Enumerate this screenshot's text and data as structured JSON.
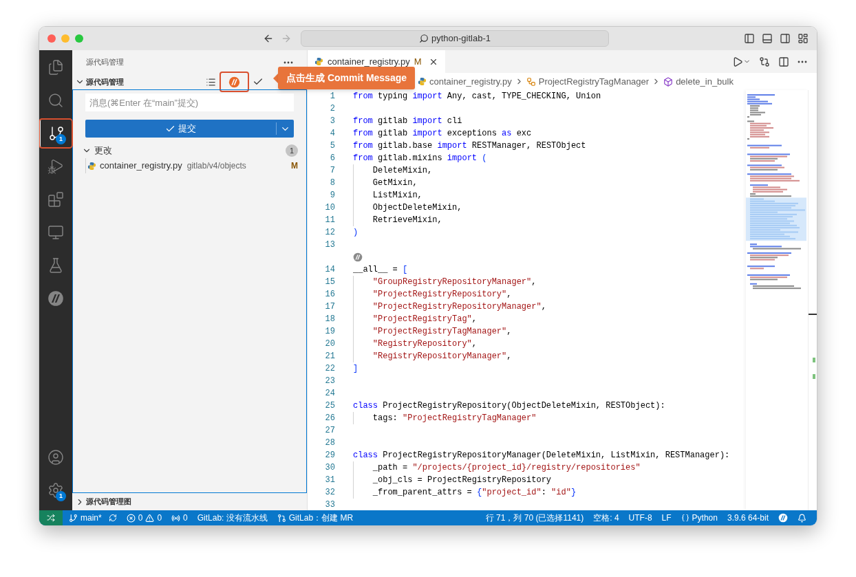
{
  "window": {
    "title": "python-gitlab-1"
  },
  "activity_bar": {
    "items": [
      {
        "kind": "files",
        "selected": false,
        "highlighted": false
      },
      {
        "kind": "search",
        "selected": false,
        "highlighted": false
      },
      {
        "kind": "source-control",
        "selected": true,
        "highlighted": true,
        "badge": "1"
      },
      {
        "kind": "run",
        "selected": false,
        "highlighted": false
      },
      {
        "kind": "extensions",
        "selected": false,
        "highlighted": false
      },
      {
        "kind": "remote",
        "selected": false,
        "highlighted": false
      },
      {
        "kind": "testing",
        "selected": false,
        "highlighted": false
      },
      {
        "kind": "logo",
        "selected": false,
        "highlighted": false
      }
    ],
    "bottom_items": [
      {
        "kind": "account",
        "selected": false,
        "highlighted": false
      },
      {
        "kind": "settings",
        "selected": false,
        "highlighted": false,
        "badge": "1"
      }
    ]
  },
  "sidebar": {
    "title": "源代码管理",
    "section": {
      "title": "源代码管理",
      "expanded": true,
      "actions": [
        {
          "kind": "list",
          "highlighted": false
        },
        {
          "kind": "logo",
          "highlighted": true
        },
        {
          "kind": "check",
          "highlighted": false
        }
      ]
    },
    "message": {
      "placeholder": "消息(⌘Enter 在“main”提交)"
    },
    "commit_button": {
      "label": "提交"
    },
    "changes": {
      "title": "更改",
      "count": "1",
      "expanded": true,
      "files": [
        {
          "name": "container_registry.py",
          "path": "gitlab/v4/objects",
          "status": "M"
        }
      ]
    },
    "graph": {
      "title": "源代码管理图",
      "expanded": false
    }
  },
  "tooltip": {
    "text": "点击生成 Commit Message"
  },
  "editor": {
    "tabs": [
      {
        "name": "container_registry.py",
        "status": "M",
        "selected": true
      }
    ],
    "breadcrumb": [
      {
        "kind": "file",
        "text": "container_registry.py"
      },
      {
        "kind": "class",
        "text": "ProjectRegistryTagManager"
      },
      {
        "kind": "method",
        "text": "delete_in_bulk"
      }
    ],
    "lines": [
      {
        "number": "1",
        "indent_guide": false,
        "tokens": [
          {
            "kind": "kw",
            "text": "from"
          },
          {
            "kind": "plain",
            "text": " typing "
          },
          {
            "kind": "kw",
            "text": "import"
          },
          {
            "kind": "plain",
            "text": " Any, cast, TYPE_CHECKING, Union"
          }
        ]
      },
      {
        "number": "2",
        "indent_guide": false
      },
      {
        "number": "3",
        "indent_guide": false,
        "tokens": [
          {
            "kind": "kw",
            "text": "from"
          },
          {
            "kind": "plain",
            "text": " gitlab "
          },
          {
            "kind": "kw",
            "text": "import"
          },
          {
            "kind": "plain",
            "text": " cli"
          }
        ]
      },
      {
        "number": "4",
        "indent_guide": false,
        "tokens": [
          {
            "kind": "kw",
            "text": "from"
          },
          {
            "kind": "plain",
            "text": " gitlab "
          },
          {
            "kind": "kw",
            "text": "import"
          },
          {
            "kind": "plain",
            "text": " exceptions "
          },
          {
            "kind": "kw",
            "text": "as"
          },
          {
            "kind": "plain",
            "text": " exc"
          }
        ]
      },
      {
        "number": "5",
        "indent_guide": false,
        "tokens": [
          {
            "kind": "kw",
            "text": "from"
          },
          {
            "kind": "plain",
            "text": " gitlab.base "
          },
          {
            "kind": "kw",
            "text": "import"
          },
          {
            "kind": "plain",
            "text": " RESTManager, RESTObject"
          }
        ]
      },
      {
        "number": "6",
        "indent_guide": false,
        "tokens": [
          {
            "kind": "kw",
            "text": "from"
          },
          {
            "kind": "plain",
            "text": " gitlab.mixins "
          },
          {
            "kind": "kw",
            "text": "import"
          },
          {
            "kind": "br",
            "text": " ("
          }
        ]
      },
      {
        "number": "7",
        "indent_guide": true,
        "tokens": [
          {
            "kind": "plain",
            "text": "DeleteMixin,"
          }
        ]
      },
      {
        "number": "8",
        "indent_guide": true,
        "tokens": [
          {
            "kind": "plain",
            "text": "GetMixin,"
          }
        ]
      },
      {
        "number": "9",
        "indent_guide": true,
        "tokens": [
          {
            "kind": "plain",
            "text": "ListMixin,"
          }
        ]
      },
      {
        "number": "10",
        "indent_guide": true,
        "tokens": [
          {
            "kind": "plain",
            "text": "ObjectDeleteMixin,"
          }
        ]
      },
      {
        "number": "11",
        "indent_guide": true,
        "tokens": [
          {
            "kind": "plain",
            "text": "RetrieveMixin,"
          }
        ]
      },
      {
        "number": "12",
        "indent_guide": false,
        "tokens": [
          {
            "kind": "br",
            "text": ")"
          }
        ]
      },
      {
        "number": "13",
        "indent_guide": false
      },
      {
        "number": "14",
        "indent_guide": false,
        "codelens": true,
        "tokens": [
          {
            "kind": "plain",
            "text": "__all__ = "
          },
          {
            "kind": "br",
            "text": "["
          }
        ]
      },
      {
        "number": "15",
        "indent_guide": true,
        "tokens": [
          {
            "kind": "str",
            "text": "\"GroupRegistryRepositoryManager\""
          },
          {
            "kind": "plain",
            "text": ","
          }
        ]
      },
      {
        "number": "16",
        "indent_guide": true,
        "tokens": [
          {
            "kind": "str",
            "text": "\"ProjectRegistryRepository\""
          },
          {
            "kind": "plain",
            "text": ","
          }
        ]
      },
      {
        "number": "17",
        "indent_guide": true,
        "tokens": [
          {
            "kind": "str",
            "text": "\"ProjectRegistryRepositoryManager\""
          },
          {
            "kind": "plain",
            "text": ","
          }
        ]
      },
      {
        "number": "18",
        "indent_guide": true,
        "tokens": [
          {
            "kind": "str",
            "text": "\"ProjectRegistryTag\""
          },
          {
            "kind": "plain",
            "text": ","
          }
        ]
      },
      {
        "number": "19",
        "indent_guide": true,
        "tokens": [
          {
            "kind": "str",
            "text": "\"ProjectRegistryTagManager\""
          },
          {
            "kind": "plain",
            "text": ","
          }
        ]
      },
      {
        "number": "20",
        "indent_guide": true,
        "tokens": [
          {
            "kind": "str",
            "text": "\"RegistryRepository\""
          },
          {
            "kind": "plain",
            "text": ","
          }
        ]
      },
      {
        "number": "21",
        "indent_guide": true,
        "tokens": [
          {
            "kind": "str",
            "text": "\"RegistryRepositoryManager\""
          },
          {
            "kind": "plain",
            "text": ","
          }
        ]
      },
      {
        "number": "22",
        "indent_guide": false,
        "tokens": [
          {
            "kind": "br",
            "text": "]"
          }
        ]
      },
      {
        "number": "23",
        "indent_guide": false
      },
      {
        "number": "24",
        "indent_guide": false
      },
      {
        "number": "25",
        "indent_guide": false,
        "tokens": [
          {
            "kind": "kw",
            "text": "class"
          },
          {
            "kind": "plain",
            "text": " ProjectRegistryRepository(ObjectDeleteMixin, RESTObject):"
          }
        ]
      },
      {
        "number": "26",
        "indent_guide": true,
        "tokens": [
          {
            "kind": "plain",
            "text": "tags: "
          },
          {
            "kind": "str",
            "text": "\"ProjectRegistryTagManager\""
          }
        ]
      },
      {
        "number": "27",
        "indent_guide": false
      },
      {
        "number": "28",
        "indent_guide": false
      },
      {
        "number": "29",
        "indent_guide": false,
        "tokens": [
          {
            "kind": "kw",
            "text": "class"
          },
          {
            "kind": "plain",
            "text": " ProjectRegistryRepositoryManager(DeleteMixin, ListMixin, RESTManager):"
          }
        ]
      },
      {
        "number": "30",
        "indent_guide": true,
        "tokens": [
          {
            "kind": "plain",
            "text": "_path = "
          },
          {
            "kind": "str",
            "text": "\"/projects/{project_id}/registry/repositories\""
          }
        ]
      },
      {
        "number": "31",
        "indent_guide": true,
        "tokens": [
          {
            "kind": "plain",
            "text": "_obj_cls = ProjectRegistryRepository"
          }
        ]
      },
      {
        "number": "32",
        "indent_guide": true,
        "tokens": [
          {
            "kind": "plain",
            "text": "_from_parent_attrs = "
          },
          {
            "kind": "br",
            "text": "{"
          },
          {
            "kind": "str",
            "text": "\"project_id\""
          },
          {
            "kind": "plain",
            "text": ": "
          },
          {
            "kind": "str",
            "text": "\"id\""
          },
          {
            "kind": "br",
            "text": "}"
          }
        ]
      },
      {
        "number": "33",
        "indent_guide": false
      }
    ]
  },
  "status_bar": {
    "left": [
      {
        "kind": "branch",
        "text": "main*"
      },
      {
        "kind": "problems",
        "errors": "0",
        "warnings": "0"
      },
      {
        "kind": "ports",
        "text": "0"
      },
      {
        "kind": "text",
        "text": "GitLab: 没有流水线"
      },
      {
        "kind": "merge",
        "text": "GitLab：创建 MR"
      }
    ],
    "right": [
      {
        "kind": "text",
        "text": "行 71，列 70 (已选择1141)"
      },
      {
        "kind": "text",
        "text": "空格: 4"
      },
      {
        "kind": "text",
        "text": "UTF-8"
      },
      {
        "kind": "text",
        "text": "LF"
      },
      {
        "kind": "language",
        "text": "Python"
      },
      {
        "kind": "text",
        "text": "3.9.6 64-bit"
      },
      {
        "kind": "logo"
      },
      {
        "kind": "bell"
      }
    ]
  }
}
